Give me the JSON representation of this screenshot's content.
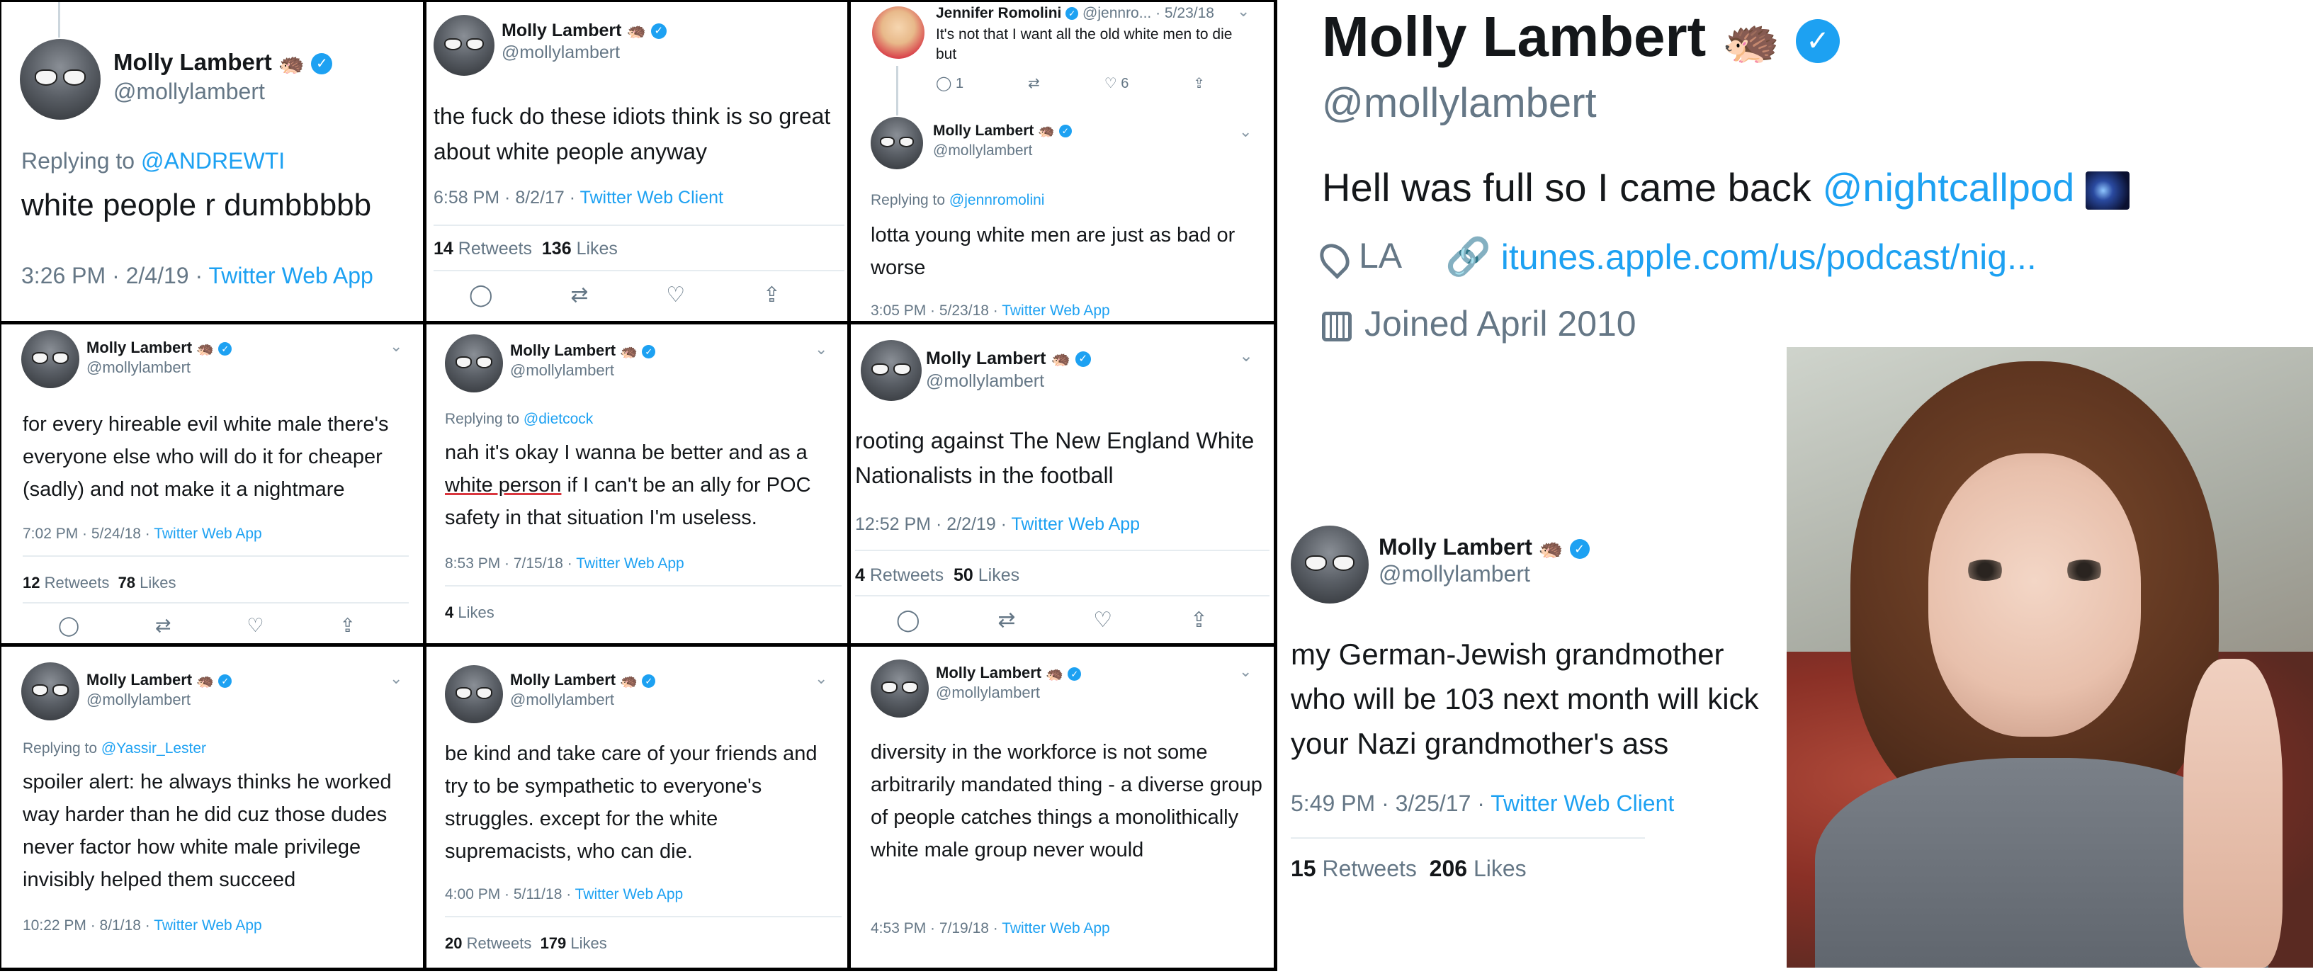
{
  "colors": {
    "link": "#1da1f2",
    "muted": "#657786",
    "text": "#14171a",
    "border": "#000000"
  },
  "common": {
    "name": "Molly Lambert",
    "handle": "@mollylambert",
    "hedgehog": "🦔",
    "verified": "✓",
    "source_app": "Twitter Web App",
    "source_client": "Twitter Web Client",
    "retweets_label": "Retweets",
    "likes_label": "Likes",
    "replying_to": "Replying to"
  },
  "tweet1": {
    "reply_to": "@ANDREWTI",
    "text": "white people r dumbbbbb",
    "time": "3:26 PM · 2/4/19 · "
  },
  "tweet2": {
    "text": "the fuck do these idiots think is so great about white people anyway",
    "time": "6:58 PM · 8/2/17 · ",
    "retweets": "14",
    "likes": "136"
  },
  "tweet3": {
    "jr_name": "Jennifer Romolini",
    "jr_handle": "@jennro... · 5/23/18",
    "jr_text": "It's not that I want all the old white men to die but",
    "jr_replies": "1",
    "jr_likes": "6",
    "reply_to": "@jennromolini",
    "text": "lotta young white men are just as bad or worse",
    "time": "3:05 PM · 5/23/18 · "
  },
  "tweet4": {
    "text": "for every hireable evil white male there's everyone else who will do it for cheaper (sadly) and not make it a nightmare",
    "time": "7:02 PM · 5/24/18 · ",
    "retweets": "12",
    "likes": "78"
  },
  "tweet5": {
    "reply_to": "@dietcock",
    "text_a": "nah it's okay I wanna be better and as a ",
    "text_b": "white person",
    "text_c": " if I can't be an ally for POC safety in that situation I'm useless.",
    "time": "8:53 PM · 7/15/18 · ",
    "likes": "4"
  },
  "tweet6": {
    "text": "rooting against The New England White Nationalists in the football",
    "time": "12:52 PM · 2/2/19 · ",
    "retweets": "4",
    "likes": "50"
  },
  "tweet7": {
    "reply_to": "@Yassir_Lester",
    "text": "spoiler alert: he always thinks he worked way harder than he did cuz those dudes never factor how white male privilege invisibly helped them succeed",
    "time": "10:22 PM · 8/1/18 · "
  },
  "tweet8": {
    "text": "be kind and take care of your friends and try to be sympathetic to everyone's struggles. except for the white supremacists, who can die.",
    "time": "4:00 PM · 5/11/18 · ",
    "retweets": "20",
    "likes": "179"
  },
  "tweet9": {
    "text": "diversity in the workforce is not some arbitrarily mandated thing - a diverse group of people catches things a monolithically white male group never would",
    "time": "4:53 PM · 7/19/18 · "
  },
  "profile": {
    "bio_text": "Hell was full so I came back ",
    "bio_link": "@nightcallpod",
    "location": "LA",
    "url": "itunes.apple.com/us/podcast/nig...",
    "joined": "Joined April 2010"
  },
  "tweet10": {
    "text": "my German-Jewish grandmother who will be 103 next month will kick your Nazi grandmother's ass",
    "time": "5:49 PM · 3/25/17 · ",
    "retweets": "15",
    "likes": "206"
  }
}
